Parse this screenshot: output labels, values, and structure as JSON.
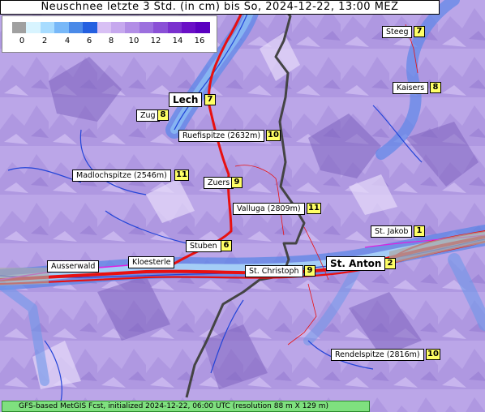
{
  "title": "Neuschnee letzte 3 Std. (in cm) bis So, 2024-12-22, 13:00 MEZ",
  "legend": {
    "ticks": [
      "0",
      "2",
      "4",
      "6",
      "8",
      "10",
      "12",
      "14",
      "16"
    ],
    "colors": [
      "#a0a0a0",
      "#d8f4ff",
      "#a8dcff",
      "#78b8f8",
      "#4a8ae8",
      "#2460e0",
      "#d8c0f4",
      "#c6a8ee",
      "#b28ee6",
      "#9c70de",
      "#8a50d6",
      "#7a30ce",
      "#6a10c6",
      "#5a00c0"
    ]
  },
  "places": [
    {
      "id": "steeg",
      "name": "Steeg",
      "value": "7"
    },
    {
      "id": "kaisers",
      "name": "Kaisers",
      "value": "8"
    },
    {
      "id": "lech",
      "name": "Lech",
      "value": "7"
    },
    {
      "id": "zug",
      "name": "Zug",
      "value": "8"
    },
    {
      "id": "ruefispitze",
      "name": "Ruefispitze (2632m)",
      "value": "10"
    },
    {
      "id": "madlochspitze",
      "name": "Madlochspitze (2546m)",
      "value": "11"
    },
    {
      "id": "zuers",
      "name": "Zuers",
      "value": "9"
    },
    {
      "id": "valluga",
      "name": "Valluga (2809m)",
      "value": "11"
    },
    {
      "id": "st_jakob",
      "name": "St. Jakob",
      "value": "1"
    },
    {
      "id": "stuben",
      "name": "Stuben",
      "value": "6"
    },
    {
      "id": "st_anton",
      "name": "St. Anton",
      "value": "2"
    },
    {
      "id": "ausserwald",
      "name": "Ausserwald",
      "value": ""
    },
    {
      "id": "kloesterle",
      "name": "Kloesterle",
      "value": ""
    },
    {
      "id": "st_christoph",
      "name": "St. Christoph",
      "value": "9"
    },
    {
      "id": "rendelspitze",
      "name": "Rendelspitze (2816m)",
      "value": "10"
    }
  ],
  "footer": "GFS-based MetGIS Fcst, initialized 2024-12-22, 06:00 UTC  (resolution 88 m X 129 m)"
}
